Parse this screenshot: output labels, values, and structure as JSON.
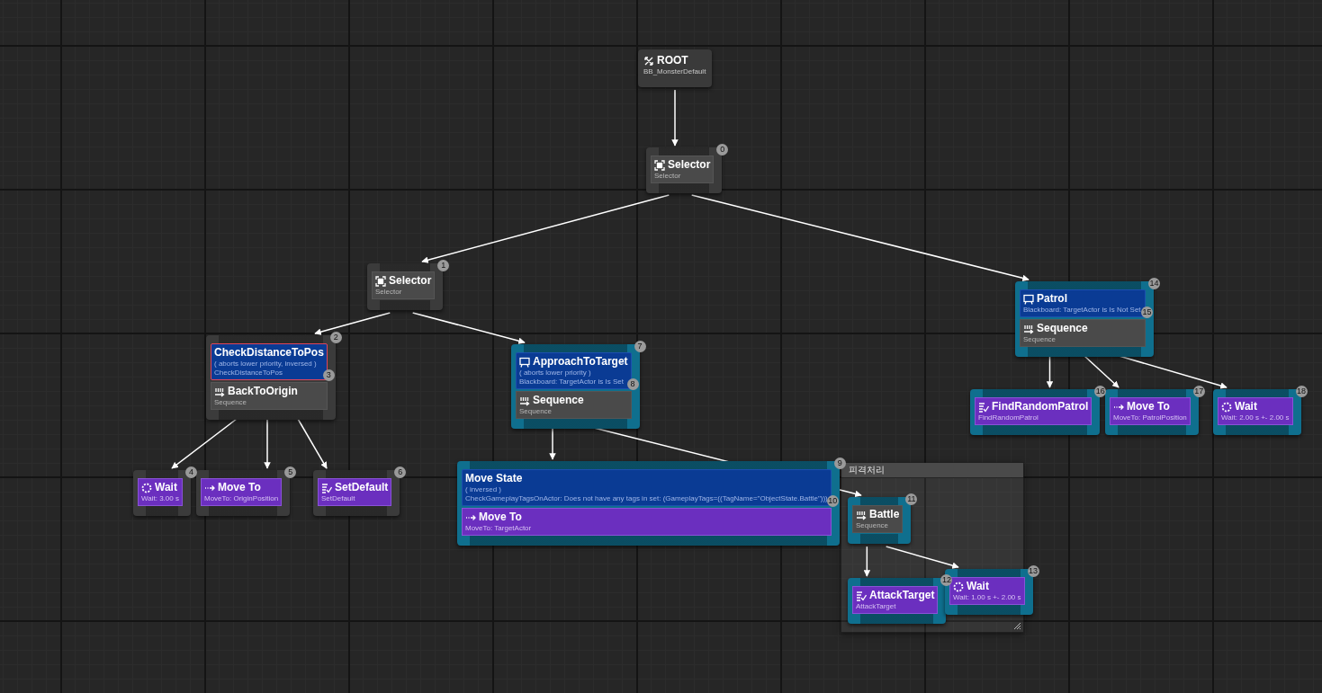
{
  "graph": {
    "root": {
      "title": "ROOT",
      "subtitle": "BB_MonsterDefault",
      "children": [
        {
          "kind": "selector",
          "title": "Selector",
          "subtitle": "Selector",
          "index": "0",
          "highlighted": false,
          "children": [
            {
              "kind": "selector",
              "title": "Selector",
              "subtitle": "Selector",
              "index": "1",
              "highlighted": false,
              "children": [
                {
                  "kind": "sequence",
                  "title": "BackToOrigin",
                  "subtitle": "Sequence",
                  "index": "2",
                  "highlighted": false,
                  "decorators": [
                    {
                      "kind": "condition",
                      "title": "CheckDistanceToPos",
                      "lines": [
                        "( aborts lower priority, inversed )",
                        "CheckDistanceToPos"
                      ],
                      "index": "3",
                      "selected": true
                    }
                  ],
                  "children": [
                    {
                      "kind": "wait",
                      "title": "Wait",
                      "subtitle": "Wait: 3.00 s",
                      "index": "4",
                      "highlighted": false
                    },
                    {
                      "kind": "move_to",
                      "title": "Move To",
                      "subtitle": "MoveTo: OriginPosition",
                      "index": "5",
                      "highlighted": false
                    },
                    {
                      "kind": "task",
                      "title": "SetDefault",
                      "subtitle": "SetDefault",
                      "index": "6",
                      "highlighted": false
                    }
                  ]
                },
                {
                  "kind": "sequence",
                  "title": "Sequence",
                  "subtitle": "Sequence",
                  "index": "7",
                  "highlighted": true,
                  "decorators": [
                    {
                      "kind": "blackboard",
                      "title": "ApproachToTarget",
                      "lines": [
                        "( aborts lower priority )",
                        "Blackboard: TargetActor is Is Set"
                      ],
                      "index": "8",
                      "selected": false
                    }
                  ],
                  "children": [
                    {
                      "kind": "move_to",
                      "title": "Move To",
                      "subtitle": "MoveTo: TargetActor",
                      "index": "9",
                      "highlighted": true,
                      "decorators": [
                        {
                          "kind": "condition",
                          "title": "Move State",
                          "lines": [
                            "( inversed )",
                            "CheckGameplayTagsOnActor: Does not have any tags in set: (GameplayTags=((TagName=\"ObjectState.Battle\")))"
                          ],
                          "index": "10",
                          "selected": false
                        }
                      ]
                    },
                    {
                      "kind": "sequence",
                      "title": "Battle",
                      "subtitle": "Sequence",
                      "index": "11",
                      "highlighted": true,
                      "children": [
                        {
                          "kind": "task",
                          "title": "AttackTarget",
                          "subtitle": "AttackTarget",
                          "index": "12",
                          "highlighted": true
                        },
                        {
                          "kind": "wait",
                          "title": "Wait",
                          "subtitle": "Wait: 1.00 s +- 2.00 s",
                          "index": "13",
                          "highlighted": true
                        }
                      ]
                    }
                  ]
                }
              ]
            },
            {
              "kind": "sequence",
              "title": "Sequence",
              "subtitle": "Sequence",
              "index": "14",
              "highlighted": true,
              "decorators": [
                {
                  "kind": "blackboard",
                  "title": "Patrol",
                  "lines": [
                    "Blackboard: TargetActor is Is Not Set"
                  ],
                  "index": "15",
                  "selected": false
                }
              ],
              "children": [
                {
                  "kind": "task",
                  "title": "FindRandomPatrol",
                  "subtitle": "FindRandomPatrol",
                  "index": "16",
                  "highlighted": true
                },
                {
                  "kind": "move_to",
                  "title": "Move To",
                  "subtitle": "MoveTo: PatrolPosition",
                  "index": "17",
                  "highlighted": true
                },
                {
                  "kind": "wait",
                  "title": "Wait",
                  "subtitle": "Wait: 2.00 s +- 2.00 s",
                  "index": "18",
                  "highlighted": true
                }
              ]
            }
          ]
        }
      ]
    }
  },
  "comment": {
    "title": "피격처리"
  }
}
